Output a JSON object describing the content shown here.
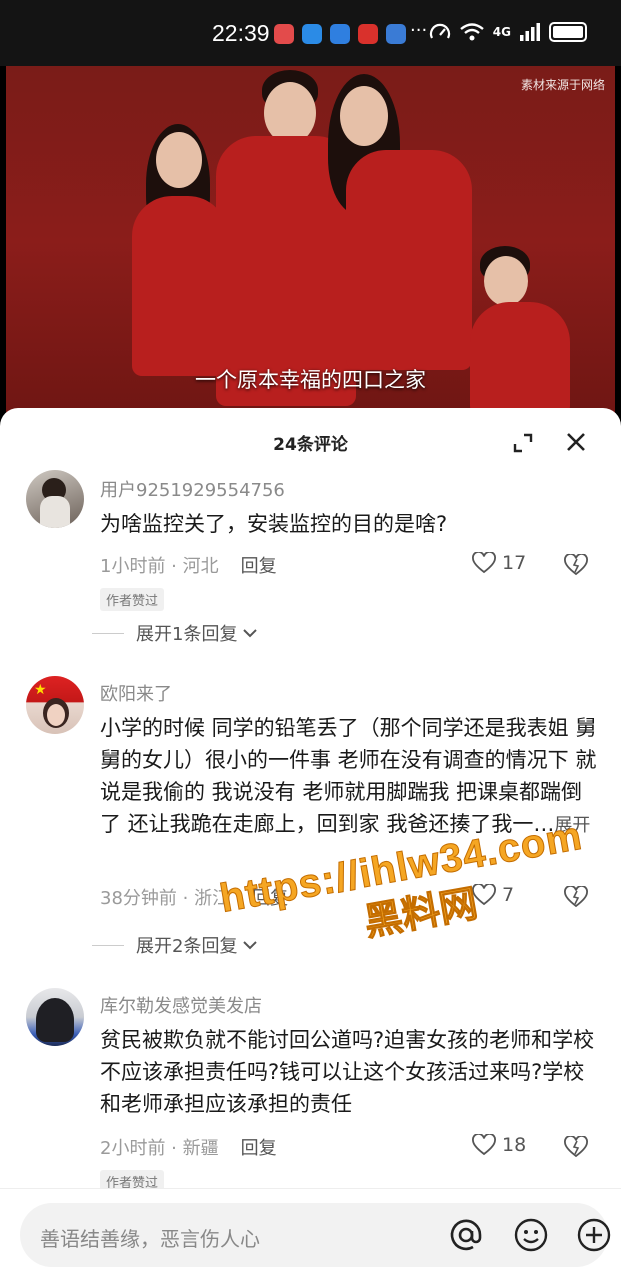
{
  "status": {
    "time": "22:39",
    "dots": "···",
    "network": "4G"
  },
  "video": {
    "source_note": "素材来源于网络",
    "subtitle": "一个原本幸福的四口之家"
  },
  "comments_panel": {
    "title": "24条评论"
  },
  "comments": [
    {
      "user": "用户9251929554756",
      "text": "为啥监控关了，安装监控的目的是啥?",
      "time_location": "1小时前 · 河北",
      "reply_label": "回复",
      "likes": "17",
      "badge": "作者赞过",
      "expand": "展开1条回复"
    },
    {
      "user": "欧阳来了",
      "text": "小学的时候 同学的铅笔丢了（那个同学还是我表姐 舅舅的女儿）很小的一件事 老师在没有调查的情况下 就说是我偷的 我说没有 老师就用脚踹我 把课桌都踹倒了 还让我跪在走廊上，回到家 我爸还揍了我一…",
      "more": "展开",
      "time_location": "38分钟前 · 浙江",
      "reply_label": "回复",
      "likes": "7",
      "expand": "展开2条回复"
    },
    {
      "user": "库尔勒发感觉美发店",
      "text": "贫民被欺负就不能讨回公道吗?迫害女孩的老师和学校不应该承担责任吗?钱可以让这个女孩活过来吗?学校和老师承担应该承担的责任",
      "time_location": "2小时前 · 新疆",
      "reply_label": "回复",
      "likes": "18",
      "badge": "作者赞过"
    }
  ],
  "watermark": {
    "url": "https://ihlw34.com",
    "name": "黑料网"
  },
  "input": {
    "placeholder": "善语结善缘，恶言伤人心"
  }
}
